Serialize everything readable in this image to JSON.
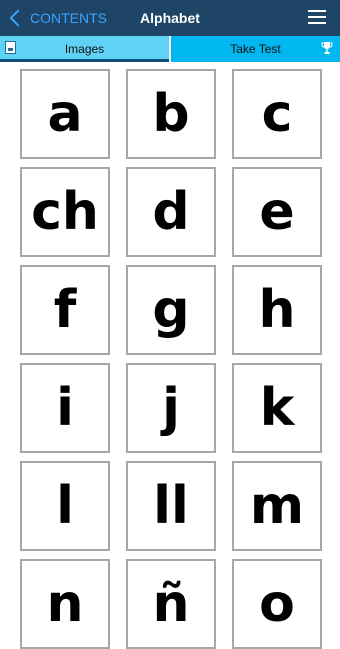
{
  "navbar": {
    "back_label": "CONTENTS",
    "title": "Alphabet"
  },
  "tabs": [
    {
      "label": "Images",
      "icon": "image-icon",
      "selected": true
    },
    {
      "label": "Take Test",
      "icon": "trophy-icon",
      "selected": false
    }
  ],
  "letters": [
    "a",
    "b",
    "c",
    "ch",
    "d",
    "e",
    "f",
    "g",
    "h",
    "i",
    "j",
    "k",
    "l",
    "ll",
    "m",
    "n",
    "ñ",
    "o"
  ],
  "colors": {
    "navbar": "#1e4466",
    "back_link": "#3aa3ff",
    "tab_selected": "#5fd2f5",
    "tab_unselected": "#00b7ef",
    "tab_indicator": "#0e4f77",
    "card_border": "#a7a7a7"
  }
}
